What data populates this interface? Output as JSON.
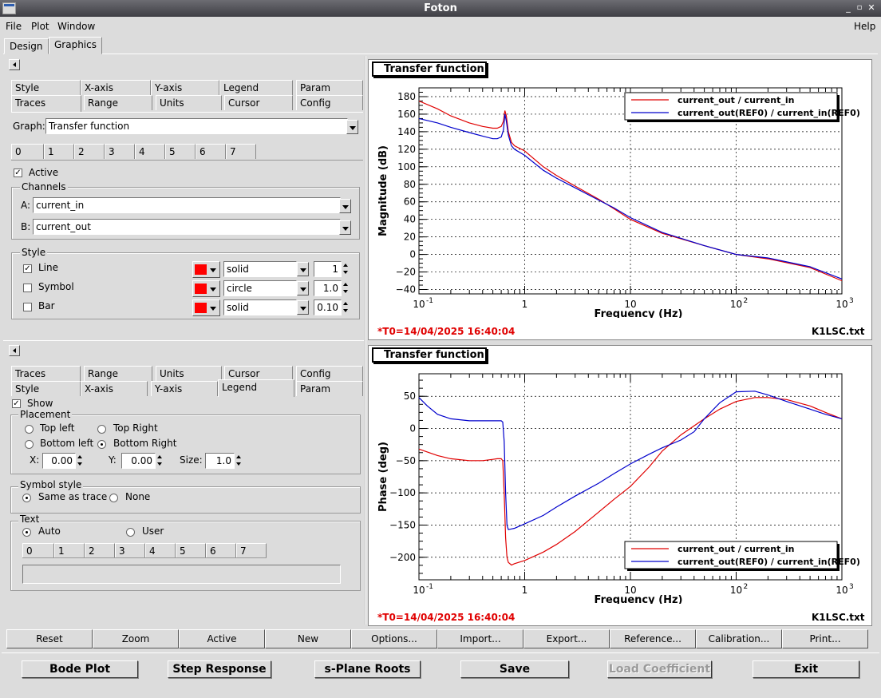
{
  "window": {
    "title": "Foton"
  },
  "menu": {
    "file": "File",
    "plot": "Plot",
    "window": "Window",
    "help": "Help"
  },
  "main_tabs": [
    "Design",
    "Graphics"
  ],
  "top_panel": {
    "tabs_row1": [
      "Style",
      "X-axis",
      "Y-axis",
      "Legend",
      "Param"
    ],
    "tabs_row2": [
      "Traces",
      "Range",
      "Units",
      "Cursor",
      "Config"
    ],
    "graph_label": "Graph:",
    "graph_value": "Transfer function",
    "trace_tabs": [
      "0",
      "1",
      "2",
      "3",
      "4",
      "5",
      "6",
      "7"
    ],
    "active_label": "Active",
    "active_checked": true,
    "channels_label": "Channels",
    "a_label": "A:",
    "a_value": "current_in",
    "b_label": "B:",
    "b_value": "current_out",
    "style_label": "Style",
    "line_label": "Line",
    "line_checked": true,
    "line_style": "solid",
    "line_width": "1",
    "symbol_label": "Symbol",
    "symbol_checked": false,
    "symbol_style": "circle",
    "symbol_size": "1.0",
    "bar_label": "Bar",
    "bar_checked": false,
    "bar_style": "solid",
    "bar_width": "0.10",
    "trace_color": "#ff0000"
  },
  "bottom_panel": {
    "tabs_row1": [
      "Traces",
      "Range",
      "Units",
      "Cursor",
      "Config"
    ],
    "tabs_row2": [
      "Style",
      "X-axis",
      "Y-axis",
      "Legend",
      "Param"
    ],
    "show_label": "Show",
    "show_checked": true,
    "placement_label": "Placement",
    "top_left": "Top left",
    "top_right": "Top Right",
    "bottom_left": "Bottom left",
    "bottom_right": "Bottom Right",
    "x_label": "X:",
    "x_value": "0.00",
    "y_label": "Y:",
    "y_value": "0.00",
    "size_label": "Size:",
    "size_value": "1.0",
    "symbol_style_label": "Symbol style",
    "same_as_trace": "Same as trace",
    "none": "None",
    "text_label": "Text",
    "auto": "Auto",
    "user": "User",
    "text_tabs": [
      "0",
      "1",
      "2",
      "3",
      "4",
      "5",
      "6",
      "7"
    ],
    "text_value": ""
  },
  "action_buttons": [
    "Reset",
    "Zoom",
    "Active",
    "New",
    "Options...",
    "Import...",
    "Export...",
    "Reference...",
    "Calibration...",
    "Print..."
  ],
  "bottom_buttons": {
    "bode": "Bode Plot",
    "step": "Step Response",
    "splane": "s-Plane Roots",
    "save": "Save",
    "load": "Load Coefficient",
    "exit": "Exit"
  },
  "plot_footer": {
    "timestamp": "*T0=14/04/2025 16:40:04",
    "file": "K1LSC.txt"
  },
  "colors": {
    "series_red": "#e00000",
    "series_blue": "#0000cc",
    "timestamp": "#e00000"
  },
  "chart_data": [
    {
      "type": "line",
      "title": "Transfer function",
      "xlabel": "Frequency (Hz)",
      "ylabel": "Magnitude (dB)",
      "xscale": "log",
      "xlim": [
        0.1,
        1000
      ],
      "ylim": [
        -45,
        190
      ],
      "xticks": [
        0.1,
        1,
        10,
        100,
        1000
      ],
      "xticklabels": [
        "10",
        "1",
        "10",
        "10",
        "10"
      ],
      "xtick_exponents": [
        "-1",
        "",
        "",
        "2",
        "3"
      ],
      "yticks": [
        -40,
        -20,
        0,
        20,
        40,
        60,
        80,
        100,
        120,
        140,
        160,
        180
      ],
      "grid": true,
      "legend_position": "top-right",
      "series": [
        {
          "name": "current_out / current_in",
          "color": "#e00000",
          "x": [
            0.1,
            0.15,
            0.2,
            0.3,
            0.4,
            0.5,
            0.55,
            0.6,
            0.63,
            0.65,
            0.67,
            0.7,
            0.75,
            0.8,
            1,
            1.5,
            2,
            3,
            5,
            7,
            10,
            20,
            50,
            100,
            200,
            500,
            1000
          ],
          "y": [
            175,
            166,
            158,
            150,
            146,
            144,
            144,
            146,
            152,
            164,
            158,
            140,
            128,
            124,
            118,
            100,
            90,
            78,
            63,
            52,
            40,
            24,
            10,
            0,
            -5,
            -15,
            -30
          ]
        },
        {
          "name": "current_out(REF0) / current_in(REF0)",
          "color": "#0000cc",
          "x": [
            0.1,
            0.15,
            0.2,
            0.3,
            0.4,
            0.5,
            0.55,
            0.6,
            0.63,
            0.65,
            0.67,
            0.7,
            0.75,
            0.8,
            1,
            1.5,
            2,
            3,
            5,
            7,
            10,
            20,
            50,
            100,
            200,
            500,
            1000
          ],
          "y": [
            155,
            150,
            145,
            139,
            135,
            132,
            132,
            134,
            142,
            160,
            152,
            136,
            124,
            120,
            113,
            96,
            87,
            76,
            62,
            53,
            42,
            25,
            10,
            0,
            -4,
            -14,
            -28
          ]
        }
      ]
    },
    {
      "type": "line",
      "title": "Transfer function",
      "xlabel": "Frequency (Hz)",
      "ylabel": "Phase (deg)",
      "xscale": "log",
      "xlim": [
        0.1,
        1000
      ],
      "ylim": [
        -235,
        85
      ],
      "xticks": [
        0.1,
        1,
        10,
        100,
        1000
      ],
      "xticklabels": [
        "10",
        "1",
        "10",
        "10",
        "10"
      ],
      "xtick_exponents": [
        "-1",
        "",
        "",
        "2",
        "3"
      ],
      "yticks": [
        -200,
        -150,
        -100,
        -50,
        0,
        50
      ],
      "grid": true,
      "legend_position": "bottom-right",
      "series": [
        {
          "name": "current_out / current_in",
          "color": "#e00000",
          "x": [
            0.1,
            0.15,
            0.2,
            0.3,
            0.4,
            0.5,
            0.55,
            0.6,
            0.62,
            0.64,
            0.66,
            0.68,
            0.7,
            0.75,
            0.8,
            1,
            1.5,
            2,
            3,
            5,
            7,
            10,
            15,
            20,
            30,
            50,
            70,
            100,
            150,
            200,
            300,
            500,
            700,
            1000
          ],
          "y": [
            -32,
            -42,
            -47,
            -50,
            -50,
            -48,
            -47,
            -47,
            -50,
            -100,
            -170,
            -200,
            -208,
            -212,
            -210,
            -205,
            -192,
            -180,
            -160,
            -130,
            -110,
            -90,
            -60,
            -35,
            -10,
            15,
            30,
            42,
            48,
            48,
            45,
            35,
            25,
            15
          ]
        },
        {
          "name": "current_out(REF0) / current_in(REF0)",
          "color": "#0000cc",
          "x": [
            0.1,
            0.12,
            0.15,
            0.2,
            0.3,
            0.4,
            0.5,
            0.55,
            0.6,
            0.62,
            0.64,
            0.66,
            0.68,
            0.7,
            0.75,
            0.8,
            1,
            1.5,
            2,
            3,
            5,
            7,
            10,
            15,
            20,
            30,
            40,
            50,
            70,
            100,
            150,
            200,
            300,
            500,
            700,
            1000
          ],
          "y": [
            48,
            35,
            22,
            15,
            12,
            12,
            12,
            12,
            12,
            10,
            -20,
            -100,
            -150,
            -157,
            -156,
            -155,
            -148,
            -135,
            -122,
            -105,
            -85,
            -70,
            -55,
            -40,
            -30,
            -18,
            -5,
            15,
            40,
            57,
            58,
            52,
            42,
            30,
            22,
            15
          ]
        }
      ]
    }
  ]
}
